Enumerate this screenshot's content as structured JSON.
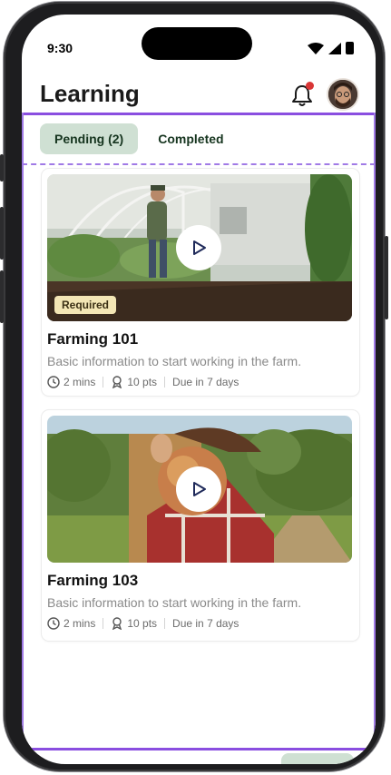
{
  "status": {
    "time": "9:30"
  },
  "header": {
    "title": "Learning"
  },
  "tabs": [
    {
      "label": "Pending (2)",
      "active": true
    },
    {
      "label": "Completed",
      "active": false
    }
  ],
  "courses": [
    {
      "title": "Farming 101",
      "badge": "Required",
      "description": "Basic information to start working in the farm.",
      "duration": "2 mins",
      "points": "10 pts",
      "due": "Due in 7 days"
    },
    {
      "title": "Farming 103",
      "badge": "",
      "description": "Basic information to start working in the farm.",
      "duration": "2 mins",
      "points": "10 pts",
      "due": "Due in 7 days"
    }
  ],
  "colors": {
    "accent_purple": "#8a4ee0",
    "tab_active_bg": "#cfe0d3",
    "badge_bg": "#f3e6b5",
    "notification_dot": "#d93636"
  },
  "icons": [
    "wifi-icon",
    "signal-icon",
    "battery-icon",
    "bell-icon",
    "play-icon",
    "clock-icon",
    "award-icon"
  ]
}
